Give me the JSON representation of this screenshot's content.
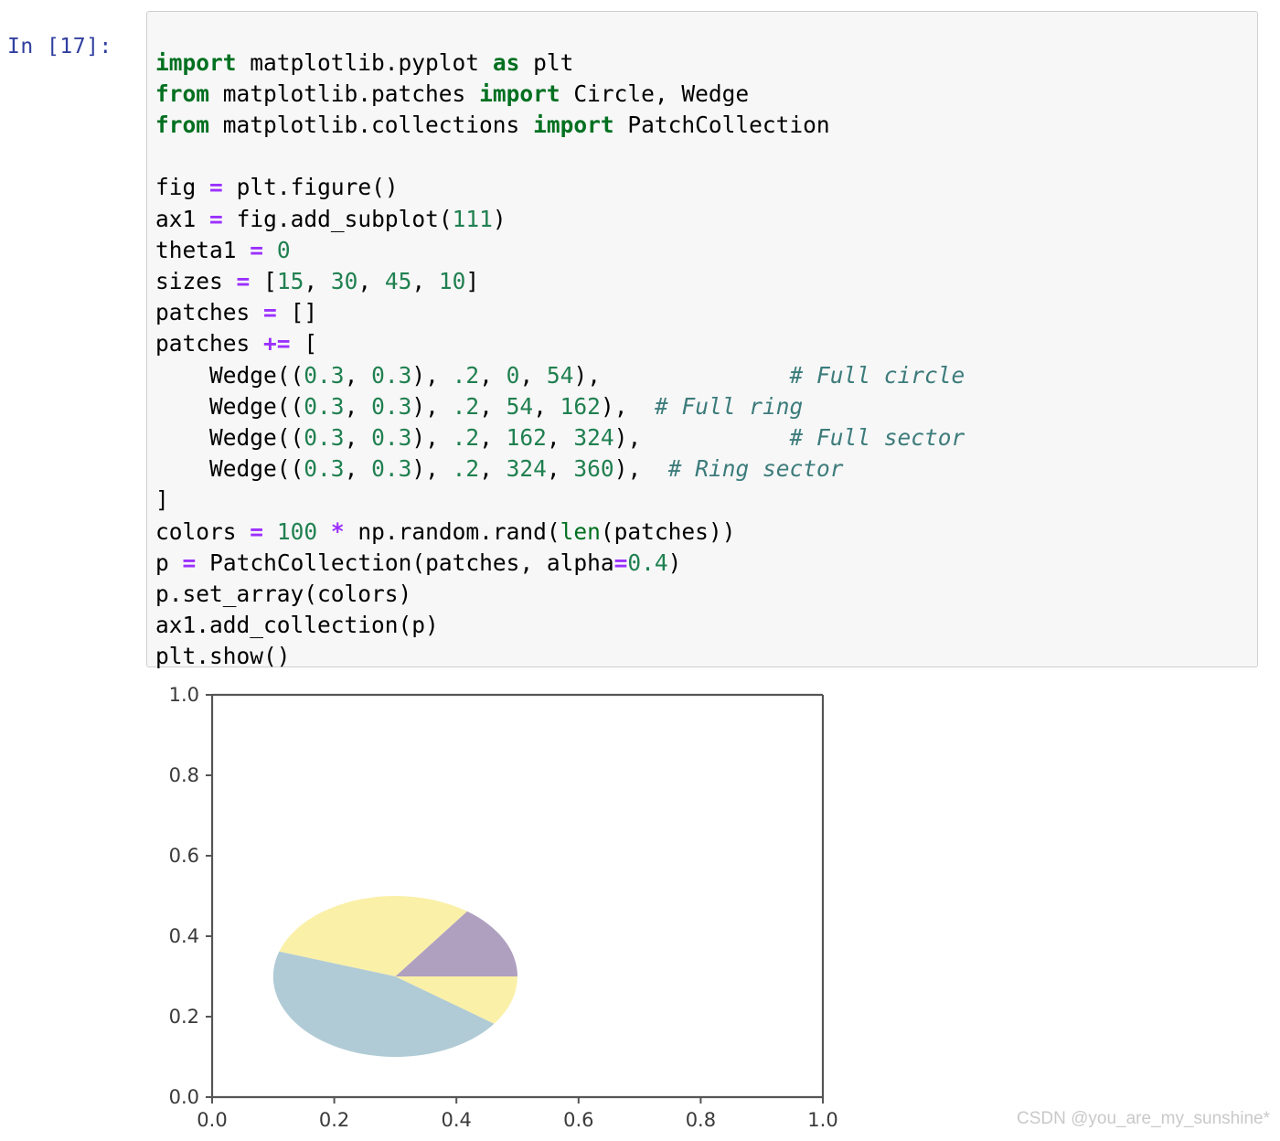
{
  "cell": {
    "prompt": "In [17]:",
    "prompt_color": "#303f9f",
    "background": "#f7f7f7",
    "border_color": "#cfcfcf",
    "code_lines": [
      "import matplotlib.pyplot as plt",
      "from matplotlib.patches import Circle, Wedge",
      "from matplotlib.collections import PatchCollection",
      "",
      "fig = plt.figure()",
      "ax1 = fig.add_subplot(111)",
      "theta1 = 0",
      "sizes = [15, 30, 45, 10]",
      "patches = []",
      "patches += [",
      "    Wedge((0.3, 0.3), .2, 0, 54),              # Full circle",
      "    Wedge((0.3, 0.3), .2, 54, 162),  # Full ring",
      "    Wedge((0.3, 0.3), .2, 162, 324),           # Full sector",
      "    Wedge((0.3, 0.3), .2, 324, 360),  # Ring sector",
      "]",
      "colors = 100 * np.random.rand(len(patches))",
      "p = PatchCollection(patches, alpha=0.4)",
      "p.set_array(colors)",
      "ax1.add_collection(p)",
      "plt.show()"
    ],
    "tokens": {
      "keyword_import": "import",
      "keyword_from": "from",
      "keyword_as": "as",
      "module_pyplot": "matplotlib.pyplot",
      "alias_plt": "plt",
      "module_patches": "matplotlib.patches",
      "class_circle": "Circle",
      "class_wedge": "Wedge",
      "module_collections": "matplotlib.collections",
      "class_patchcollection": "PatchCollection",
      "var_fig": "fig",
      "call_figure": "plt.figure()",
      "var_ax1": "ax1",
      "call_add_subplot": "fig.add_subplot(",
      "subplot_arg": "111",
      "var_theta1": "theta1",
      "theta1_value": "0",
      "var_sizes": "sizes",
      "sizes_value": "[15, 30, 45, 10]",
      "var_patches": "patches",
      "empty_list": "[]",
      "plus_equals": "+=",
      "open_bracket": "[",
      "close_bracket": "]",
      "var_colors": "colors",
      "colors_scale": "100",
      "star": "*",
      "rand_call": "np.random.rand(",
      "builtin_len": "len",
      "var_p": "p",
      "alpha_kwarg": "alpha",
      "alpha_value": "0.4",
      "set_array_call": "p.set_array(colors)",
      "add_collection_call": "ax1.add_collection(p)",
      "show_call": "plt.show()",
      "comment_full_circle": "# Full circle",
      "comment_full_ring": "# Full ring",
      "comment_full_sector": "# Full sector",
      "comment_ring_sector": "# Ring sector"
    },
    "colors": {
      "keyword": "#007020",
      "operator": "#9b30ff",
      "number": "#208050",
      "comment": "#3d7b7b",
      "text": "#000000"
    }
  },
  "chart_data": {
    "type": "pie",
    "title": "",
    "xlabel": "",
    "ylabel": "",
    "xlim": [
      0.0,
      1.0
    ],
    "ylim": [
      0.0,
      1.0
    ],
    "grid": false,
    "legend": "none",
    "xticks": [
      "0.0",
      "0.2",
      "0.4",
      "0.6",
      "0.8",
      "1.0"
    ],
    "yticks": [
      "0.0",
      "0.2",
      "0.4",
      "0.6",
      "0.8",
      "1.0"
    ],
    "xtick_values": [
      0.0,
      0.2,
      0.4,
      0.6,
      0.8,
      1.0
    ],
    "ytick_values": [
      0.0,
      0.2,
      0.4,
      0.6,
      0.8,
      1.0
    ],
    "center": [
      0.3,
      0.3
    ],
    "radius": 0.2,
    "alpha": 0.4,
    "wedges": [
      {
        "label": "Full circle",
        "theta1": 0,
        "theta2": 54,
        "span": 54,
        "color": "#b0a0c0"
      },
      {
        "label": "Full ring",
        "theta1": 54,
        "theta2": 162,
        "span": 108,
        "color": "#faf0a8"
      },
      {
        "label": "Full sector",
        "theta1": 162,
        "theta2": 324,
        "span": 162,
        "color": "#b0cbd5"
      },
      {
        "label": "Ring sector",
        "theta1": 324,
        "theta2": 360,
        "span": 36,
        "color": "#faf0a8"
      }
    ],
    "axis_color": "#555555",
    "tick_label_color": "#3a3a3a",
    "background": "#ffffff"
  },
  "watermark": {
    "text": "CSDN @you_are_my_sunshine*",
    "color": "#c9c9c9"
  }
}
